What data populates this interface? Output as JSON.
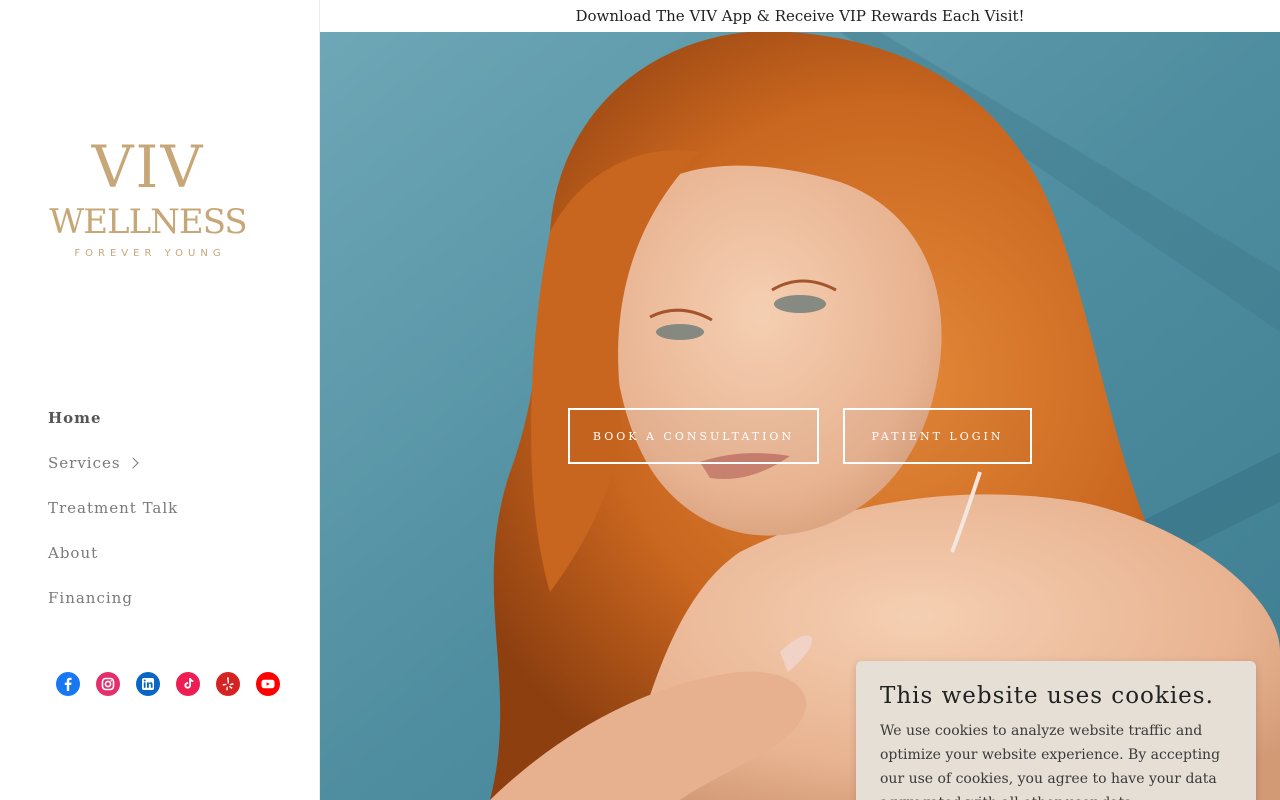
{
  "banner": {
    "text": "Download The VIV App & Receive VIP Rewards Each Visit!"
  },
  "logo": {
    "line1": "VIV",
    "line2": "WELLNESS",
    "tagline": "FOREVER YOUNG"
  },
  "nav": {
    "items": [
      {
        "label": "Home",
        "active": true
      },
      {
        "label": "Services",
        "has_submenu": true
      },
      {
        "label": "Treatment Talk"
      },
      {
        "label": "About"
      },
      {
        "label": "Financing"
      }
    ]
  },
  "socials": [
    {
      "icon": "facebook-icon",
      "color": "#1877f2"
    },
    {
      "icon": "instagram-icon",
      "color": "#e1306c"
    },
    {
      "icon": "linkedin-icon",
      "color": "#0a66c2"
    },
    {
      "icon": "tiktok-icon",
      "color": "#ee1d52"
    },
    {
      "icon": "yelp-icon",
      "color": "#d32323"
    },
    {
      "icon": "youtube-icon",
      "color": "#ff0000"
    }
  ],
  "hero": {
    "buttons": {
      "book": "BOOK A CONSULTATION",
      "login": "PATIENT LOGIN"
    }
  },
  "cookie": {
    "title": "This website uses cookies.",
    "body": "We use cookies to analyze website traffic and optimize your website experience. By accepting our use of cookies, you agree to have your data aggregated with all other user data."
  },
  "colors": {
    "accent": "#c7a777",
    "hero_bg": "#4e8da0",
    "cookie_bg": "#e6dfd5"
  }
}
